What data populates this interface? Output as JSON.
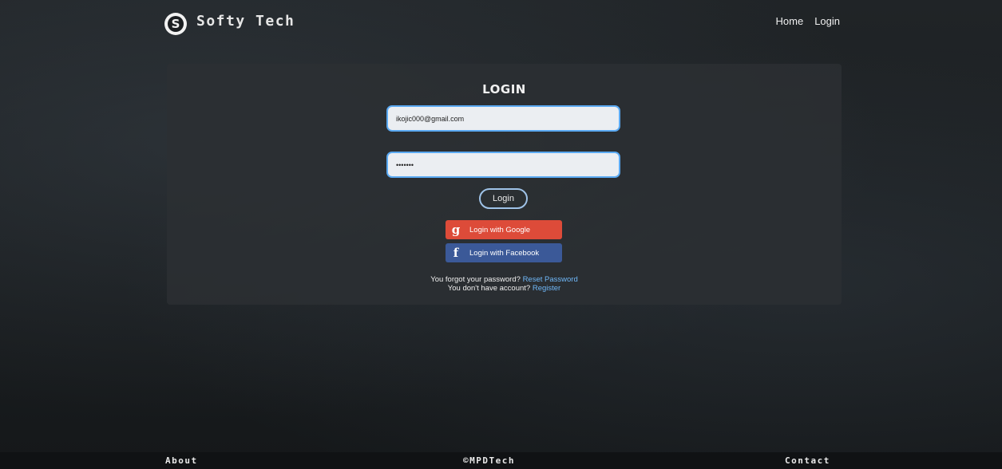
{
  "header": {
    "brand": "Softy Tech",
    "nav": {
      "home": "Home",
      "login": "Login"
    }
  },
  "login": {
    "title": "LOGIN",
    "email_value": "ikojic000@gmail.com",
    "password_value": "•••••••",
    "submit_label": "Login",
    "google_label": "Login with Google",
    "facebook_label": "Login with Facebook",
    "forgot_text": "You forgot your password?",
    "reset_link": "Reset Password",
    "no_account_text": "You don't have account?",
    "register_link": "Register"
  },
  "footer": {
    "about": "About",
    "copyright": "©MPDTech",
    "contact": "Contact"
  },
  "icons": {
    "logo": "softy-tech-logo",
    "google": "google-icon",
    "facebook": "facebook-icon"
  },
  "colors": {
    "field_border": "#5aa9f2",
    "google": "#dd4b39",
    "facebook": "#3b5998",
    "link": "#6fb7f7"
  }
}
